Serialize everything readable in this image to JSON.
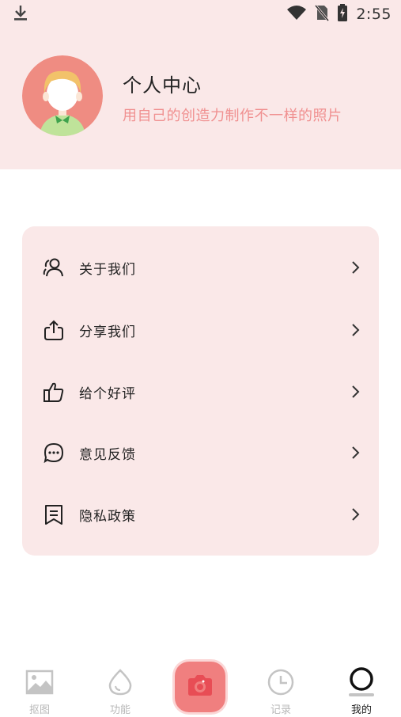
{
  "status_bar": {
    "time": "2:55",
    "icons": [
      "download-icon",
      "wifi-icon",
      "no-sim-icon",
      "battery-icon"
    ]
  },
  "profile": {
    "title": "个人中心",
    "subtitle": "用自己的创造力制作不一样的照片",
    "subtitle_color": "#f09090"
  },
  "menu": {
    "items": [
      {
        "label": "关于我们",
        "icon": "about-us-icon"
      },
      {
        "label": "分享我们",
        "icon": "share-icon"
      },
      {
        "label": "给个好评",
        "icon": "thumbs-up-icon"
      },
      {
        "label": "意见反馈",
        "icon": "feedback-icon"
      },
      {
        "label": "隐私政策",
        "icon": "privacy-policy-icon"
      }
    ]
  },
  "bottom_nav": {
    "items": [
      {
        "label": "抠图",
        "icon": "image-icon",
        "active": false
      },
      {
        "label": "功能",
        "icon": "drop-icon",
        "active": false
      },
      {
        "label": "",
        "icon": "camera-icon",
        "active": false
      },
      {
        "label": "记录",
        "icon": "clock-icon",
        "active": false
      },
      {
        "label": "我的",
        "icon": "profile-ring-icon",
        "active": true
      }
    ]
  },
  "colors": {
    "accent": "#f07f7f",
    "panel_background": "#fae8e8",
    "inactive": "#b8b8b8"
  }
}
